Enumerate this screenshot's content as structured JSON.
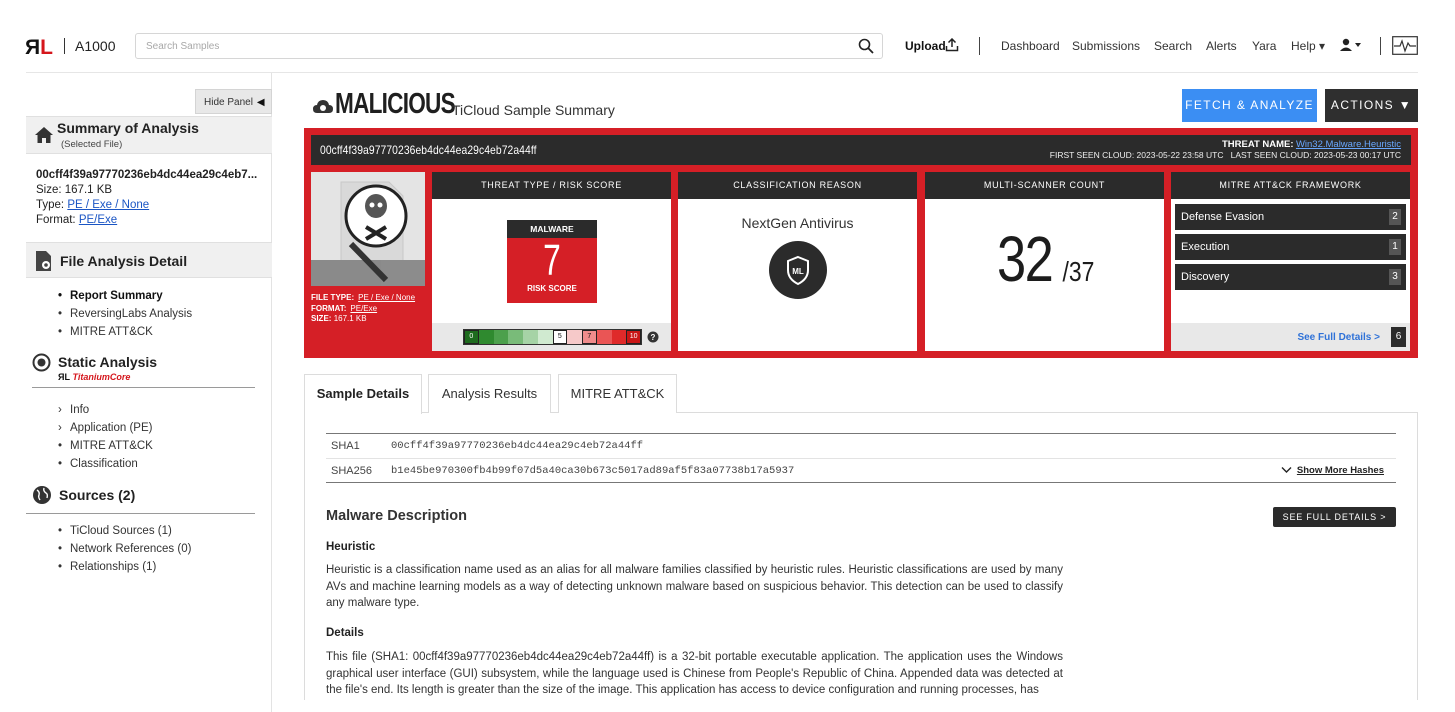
{
  "app": {
    "product": "A1000"
  },
  "search": {
    "placeholder": "Search Samples"
  },
  "nav": {
    "upload": "Upload",
    "links": [
      "Dashboard",
      "Submissions",
      "Search",
      "Alerts",
      "Yara",
      "Help ▾"
    ]
  },
  "sidebar": {
    "hide_panel": "Hide Panel",
    "summary_title": "Summary of Analysis",
    "summary_sub": "(Selected File)",
    "file_name": "00cff4f39a97770236eb4dc44ea29c4eb7...",
    "size_label": "Size: ",
    "size": "167.1 KB",
    "type_label": "Type: ",
    "type": "PE / Exe / None",
    "format_label": "Format: ",
    "format": "PE/Exe",
    "fad_title": "File Analysis Detail",
    "fad_items": [
      "Report Summary",
      "ReversingLabs Analysis",
      "MITRE ATT&CK"
    ],
    "static_title": "Static Analysis",
    "titanium_rl": "ЯL",
    "titanium": "TitaniumCore",
    "static_items": [
      "Info",
      "Application (PE)",
      "MITRE ATT&CK",
      "Classification"
    ],
    "sources_title": "Sources (2)",
    "sources_items": [
      "TiCloud Sources (1)",
      "Network References (0)",
      "Relationships (1)"
    ]
  },
  "header": {
    "verdict": "MALICIOUS",
    "subtitle": "TiCloud Sample Summary",
    "fetch": "FETCH & ANALYZE",
    "actions": "ACTIONS"
  },
  "card": {
    "sha1": "00cff4f39a97770236eb4dc44ea29c4eb72a44ff",
    "threat_name_label": "THREAT NAME:",
    "threat_name": "Win32.Malware.Heuristic",
    "first_seen": "FIRST SEEN CLOUD: 2023-05-22 23:58 UTC",
    "last_seen": "LAST SEEN CLOUD: 2023-05-23 00:17 UTC",
    "file_type_label": "FILE TYPE:",
    "file_type": "PE / Exe / None",
    "format_label": "FORMAT:",
    "format": "PE/Exe",
    "size_label": "SIZE:",
    "size": "167.1 KB",
    "threat_panel": {
      "title": "THREAT TYPE / RISK SCORE",
      "type": "MALWARE",
      "score": "7",
      "score_label": "RISK SCORE",
      "scale_labels": [
        "0",
        "5",
        "7",
        "10"
      ]
    },
    "reason_panel": {
      "title": "CLASSIFICATION REASON",
      "reason": "NextGen Antivirus"
    },
    "scanner_panel": {
      "title": "MULTI-SCANNER COUNT",
      "detected": "32",
      "total": "/37"
    },
    "mitre_panel": {
      "title": "MITRE ATT&CK FRAMEWORK",
      "tactics": [
        {
          "name": "Defense Evasion",
          "count": "2"
        },
        {
          "name": "Execution",
          "count": "1"
        },
        {
          "name": "Discovery",
          "count": "3"
        }
      ],
      "see_full": "See Full Details >",
      "total": "6"
    }
  },
  "tabs": [
    "Sample Details",
    "Analysis Results",
    "MITRE ATT&CK"
  ],
  "hashes": {
    "sha1_label": "SHA1",
    "sha1": "00cff4f39a97770236eb4dc44ea29c4eb72a44ff",
    "sha256_label": "SHA256",
    "sha256": "b1e45be970300fb4b99f07d5a40ca30b673c5017ad89af5f83a07738b17a5937",
    "show_more": "Show More Hashes"
  },
  "description": {
    "title": "Malware Description",
    "see_full": "SEE FULL DETAILS >",
    "heuristic_heading": "Heuristic",
    "heuristic_text": "Heuristic is a classification name used as an alias for all malware families classified by heuristic rules. Heuristic classifications are used by many AVs and machine learning models as a way of detecting unknown malware based on suspicious behavior. This detection can be used to classify any malware type.",
    "details_heading": "Details",
    "details_text": "This file (SHA1: 00cff4f39a97770236eb4dc44ea29c4eb72a44ff) is a 32-bit portable executable application. The application uses the Windows graphical user interface (GUI) subsystem, while the language used is Chinese from People's Republic of China. Appended data was detected at the file's end. Its length is greater than the size of the image. This application has access to device configuration and running processes, has"
  }
}
